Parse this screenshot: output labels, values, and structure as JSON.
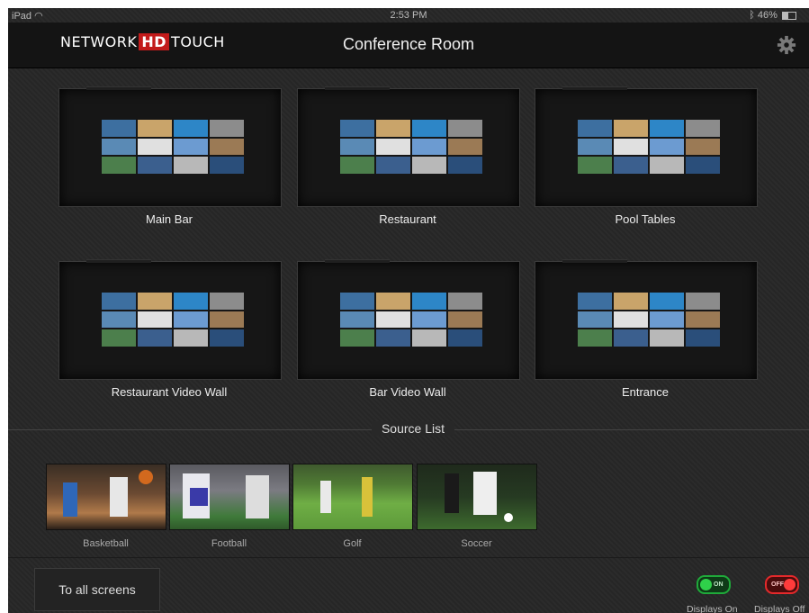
{
  "status": {
    "carrier": "iPad",
    "time": "2:53 PM",
    "battery": "46%",
    "battery_level": 0.46
  },
  "header": {
    "logo_left": "NETWORK",
    "logo_hd": "HD",
    "logo_right": "TOUCH",
    "title": "Conference Room"
  },
  "zones": [
    {
      "label": "Main Bar"
    },
    {
      "label": "Restaurant"
    },
    {
      "label": "Pool Tables"
    },
    {
      "label": "Restaurant Video Wall"
    },
    {
      "label": "Bar Video Wall"
    },
    {
      "label": "Entrance"
    }
  ],
  "source_list": {
    "title": "Source List",
    "items": [
      {
        "label": "Basketball"
      },
      {
        "label": "Football"
      },
      {
        "label": "Golf"
      },
      {
        "label": "Soccer"
      }
    ]
  },
  "footer": {
    "to_all_screens": "To all screens",
    "displays_on": {
      "state": "ON",
      "label": "Displays On"
    },
    "displays_off": {
      "state": "OFF",
      "label": "Displays Off"
    }
  },
  "colors": {
    "accent_green": "#1faa3a",
    "accent_red": "#e5292b",
    "logo_red": "#c21b1b"
  }
}
